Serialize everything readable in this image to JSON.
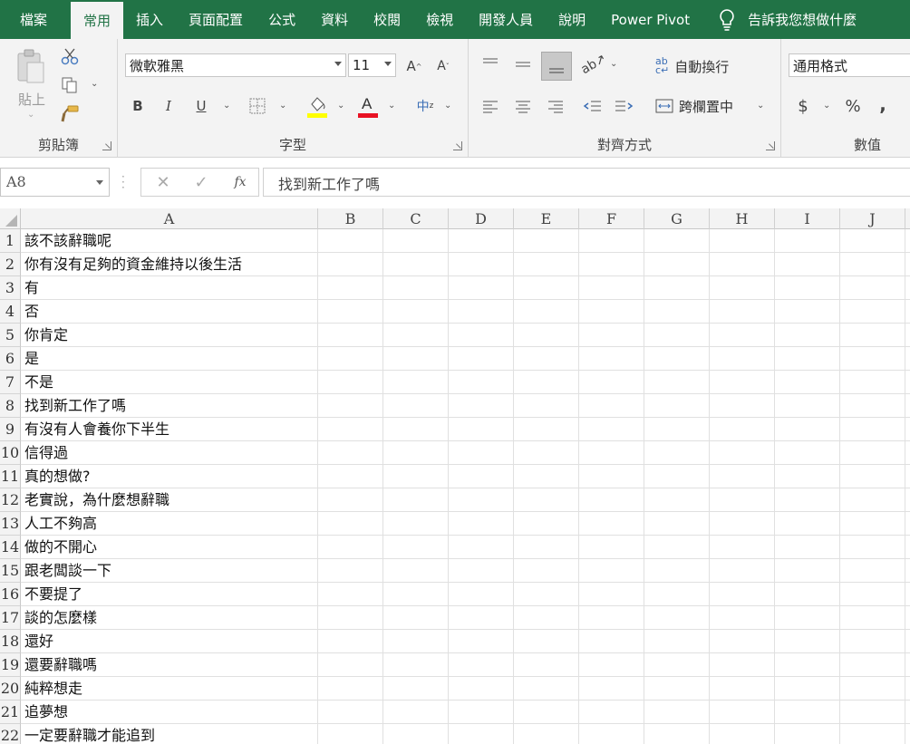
{
  "ribbon_tabs": [
    "檔案",
    "常用",
    "插入",
    "頁面配置",
    "公式",
    "資料",
    "校閱",
    "檢視",
    "開發人員",
    "說明",
    "Power Pivot"
  ],
  "active_tab_index": 1,
  "tell_me": "告訴我您想做什麼",
  "groups": {
    "clipboard": {
      "label": "剪貼簿",
      "paste": "貼上"
    },
    "font": {
      "label": "字型",
      "font_name": "微軟雅黑",
      "font_size": "11",
      "fill_color": "#ffff00",
      "font_color": "#e81123"
    },
    "alignment": {
      "label": "對齊方式",
      "wrap_text": "自動換行",
      "merge_center": "跨欄置中"
    },
    "number": {
      "label": "數值",
      "format": "通用格式",
      "currency": "$",
      "percent": "%",
      "comma": ","
    }
  },
  "formula_bar": {
    "name_box": "A8",
    "content": "找到新工作了嗎",
    "fx": "fx"
  },
  "columns": [
    "A",
    "B",
    "C",
    "D",
    "E",
    "F",
    "G",
    "H",
    "I",
    "J"
  ],
  "rows": [
    {
      "n": "1",
      "a": "該不該辭職呢"
    },
    {
      "n": "2",
      "a": "你有沒有足夠的資金維持以後生活"
    },
    {
      "n": "3",
      "a": "有"
    },
    {
      "n": "4",
      "a": "否"
    },
    {
      "n": "5",
      "a": "你肯定"
    },
    {
      "n": "6",
      "a": "是"
    },
    {
      "n": "7",
      "a": "不是"
    },
    {
      "n": "8",
      "a": "找到新工作了嗎"
    },
    {
      "n": "9",
      "a": "有沒有人會養你下半生"
    },
    {
      "n": "10",
      "a": "信得過"
    },
    {
      "n": "11",
      "a": "真的想做?"
    },
    {
      "n": "12",
      "a": "老實說，為什麼想辭職"
    },
    {
      "n": "13",
      "a": "人工不夠高"
    },
    {
      "n": "14",
      "a": "做的不開心"
    },
    {
      "n": "15",
      "a": "跟老闆談一下"
    },
    {
      "n": "16",
      "a": "不要提了"
    },
    {
      "n": "17",
      "a": "談的怎麼樣"
    },
    {
      "n": "18",
      "a": "還好"
    },
    {
      "n": "19",
      "a": "還要辭職嗎"
    },
    {
      "n": "20",
      "a": "純粹想走"
    },
    {
      "n": "21",
      "a": "追夢想"
    },
    {
      "n": "22",
      "a": "一定要辭職才能追到"
    }
  ],
  "colors": {
    "brand": "#217346"
  }
}
